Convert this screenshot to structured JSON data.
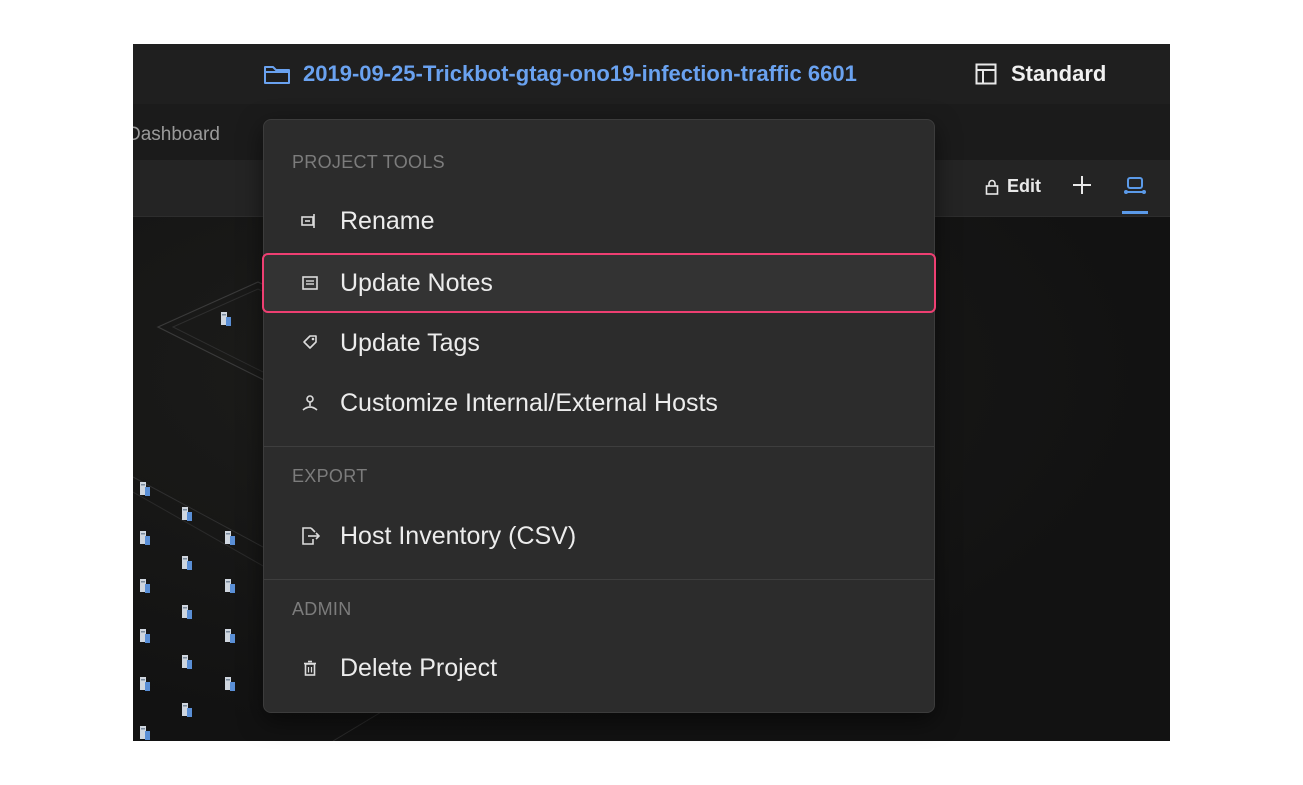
{
  "topbar": {
    "project_title": "2019-09-25-Trickbot-gtag-ono19-infection-traffic 6601",
    "layout_label": "Standard"
  },
  "tabs": {
    "dashboard_label": "Dashboard"
  },
  "toolbar": {
    "edit_label": "Edit"
  },
  "menu": {
    "sections": [
      {
        "label": "PROJECT TOOLS",
        "items": [
          {
            "label": "Rename",
            "icon": "rename-icon"
          },
          {
            "label": "Update Notes",
            "icon": "notes-icon",
            "highlighted": true
          },
          {
            "label": "Update Tags",
            "icon": "tag-icon"
          },
          {
            "label": "Customize Internal/External Hosts",
            "icon": "hosts-icon"
          }
        ]
      },
      {
        "label": "EXPORT",
        "items": [
          {
            "label": "Host Inventory (CSV)",
            "icon": "export-icon"
          }
        ]
      },
      {
        "label": "ADMIN",
        "items": [
          {
            "label": "Delete Project",
            "icon": "trash-icon"
          }
        ]
      }
    ]
  },
  "colors": {
    "accent": "#6aa2f0",
    "highlight_border": "#ee3f72",
    "menu_bg": "#2c2c2c",
    "app_bg": "#161616"
  }
}
